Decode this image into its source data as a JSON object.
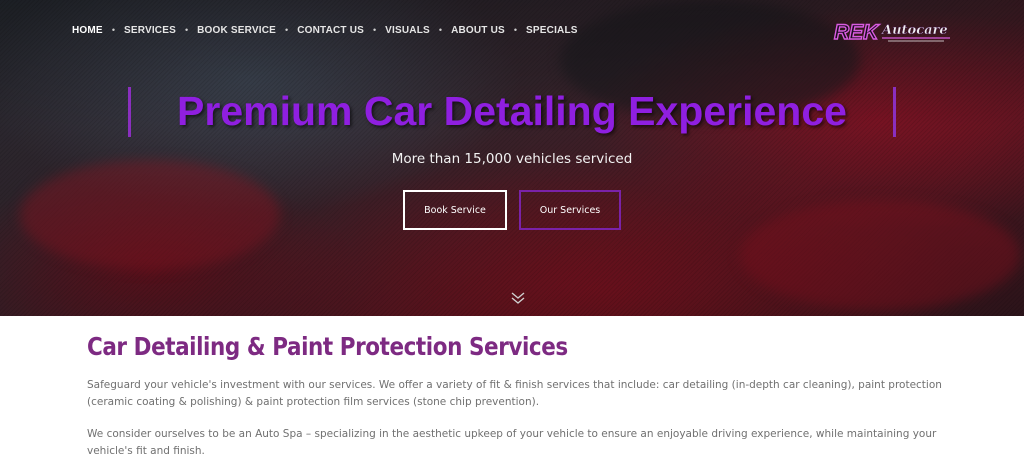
{
  "nav": {
    "items": [
      {
        "label": "HOME",
        "active": true
      },
      {
        "label": "SERVICES"
      },
      {
        "label": "BOOK SERVICE"
      },
      {
        "label": "CONTACT US"
      },
      {
        "label": "VISUALS"
      },
      {
        "label": "ABOUT US"
      },
      {
        "label": "SPECIALS"
      }
    ],
    "separator": "•"
  },
  "logo": {
    "brand_main": "REK",
    "brand_script": "Autocare"
  },
  "hero": {
    "title": "Premium Car Detailing Experience",
    "subtitle": "More than 15,000 vehicles serviced",
    "book_button": "Book Service",
    "services_button": "Our Services",
    "scroll_icon": "double-chevron-down-icon"
  },
  "content": {
    "title": "Car Detailing & Paint Protection Services",
    "paragraph1": "Safeguard your vehicle's investment with our services. We offer a variety of fit & finish services that include: car detailing (in-depth car cleaning), paint protection (ceramic coating & polishing) & paint protection film services (stone chip prevention).",
    "paragraph2": "We consider ourselves to be an Auto Spa – specializing in the aesthetic upkeep of your vehicle to ensure an enjoyable driving experience, while maintaining your vehicle's fit and finish."
  },
  "colors": {
    "accent_purple": "#8f1fe0",
    "heading_purple": "#7d2a82",
    "body_text": "#707070",
    "button_border": "#7a22a8"
  }
}
